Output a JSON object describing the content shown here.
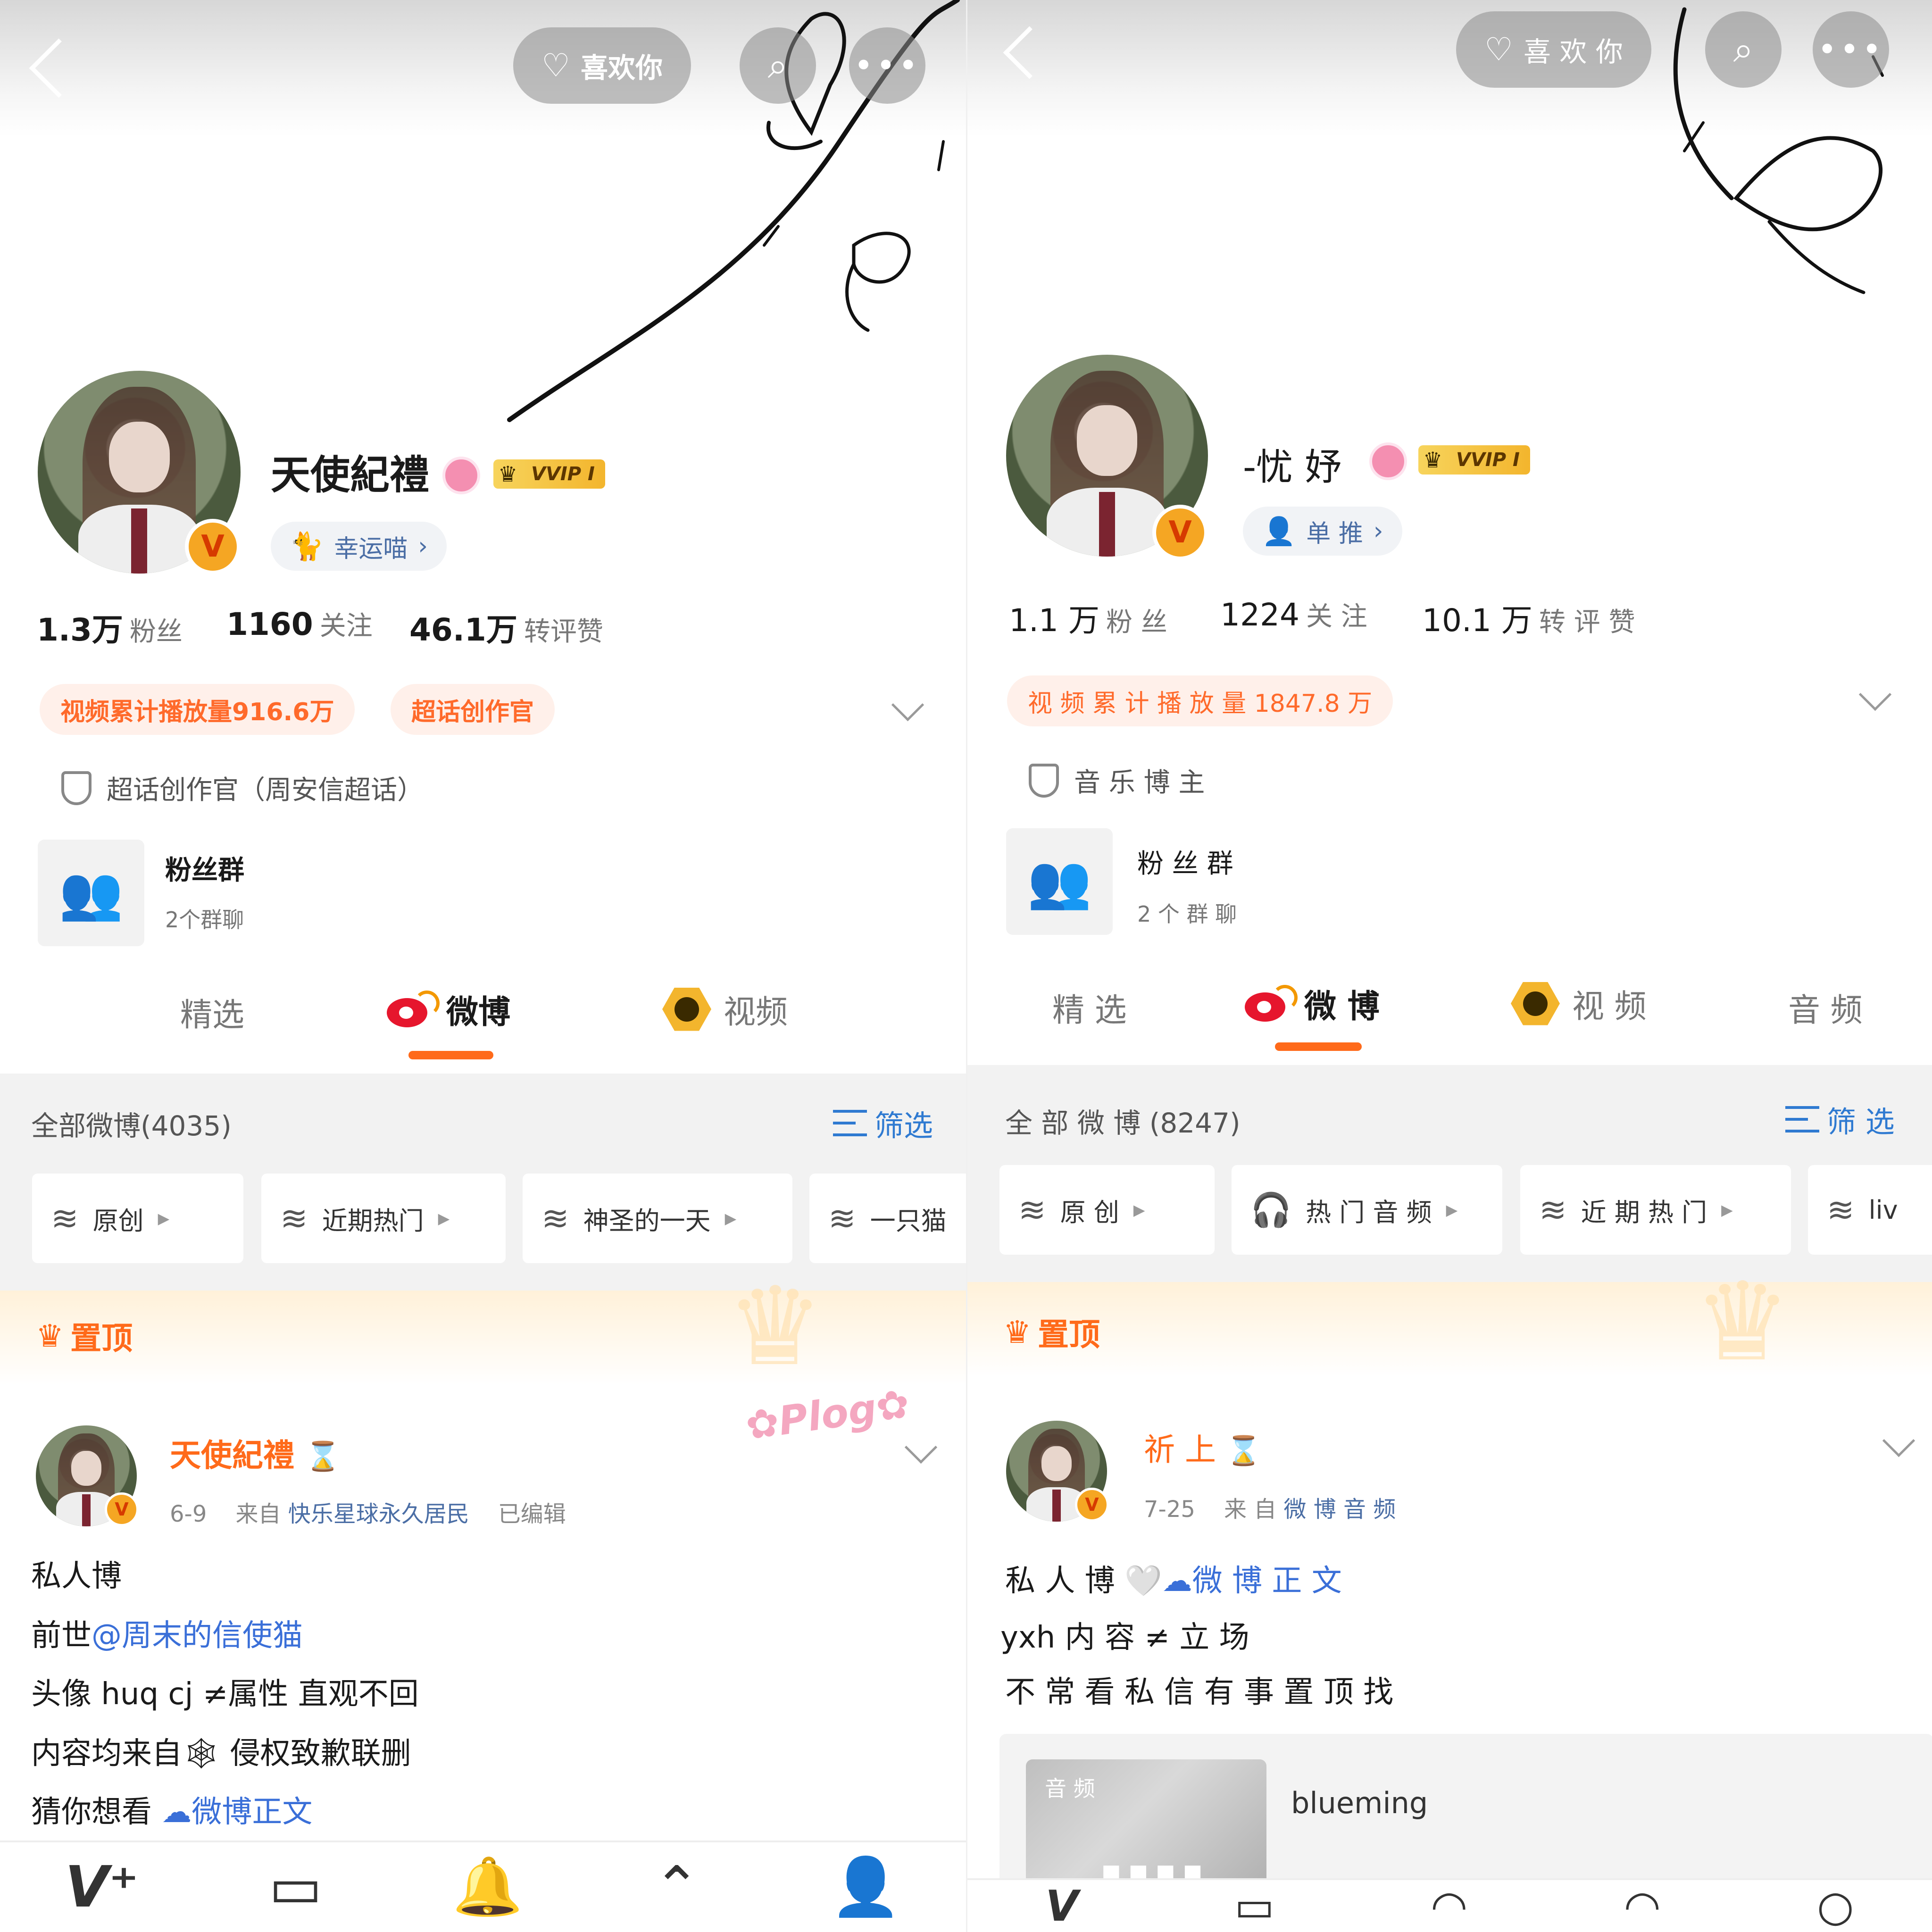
{
  "left": {
    "header": {
      "like_label": "喜欢你",
      "back_icon": "back-icon",
      "search_icon": "search-icon",
      "more_icon": "more-icon"
    },
    "profile": {
      "name": "天使紀禮",
      "vvip_label": "VVIP I",
      "tag_label": "幸运喵",
      "stats": [
        {
          "value": "1.3万",
          "label": "粉丝"
        },
        {
          "value": "1160",
          "label": "关注"
        },
        {
          "value": "46.1万",
          "label": "转评赞"
        }
      ],
      "badges": [
        "视频累计播放量916.6万",
        "超话创作官"
      ],
      "certification": "超话创作官（周安信超话）",
      "fan_group": {
        "title": "粉丝群",
        "subtitle": "2个群聊"
      }
    },
    "tabs": [
      "精选",
      "微博",
      "视频"
    ],
    "feed": {
      "all_count": "全部微博(4035)",
      "filter_label": "筛选",
      "chips": [
        "原创",
        "近期热门",
        "神圣的一天",
        "一只猫"
      ],
      "pinned_label": "置顶",
      "post": {
        "author": "天使紀禮",
        "date": "6-9",
        "from_label": "来自",
        "source": "快乐星球永久居民",
        "edited": "已编辑",
        "lines": [
          {
            "text": "私人博"
          },
          {
            "prefix": "前世",
            "link": "@周末的信使猫"
          },
          {
            "text": "头像 huq cj ≠属性 直观不回"
          },
          {
            "prefix": "内容均来自",
            "icon": "🕸",
            "suffix": " 侵权致歉联删"
          },
          {
            "prefix": "猜你想看 ",
            "link": "☁微博正文"
          }
        ]
      }
    }
  },
  "right": {
    "header": {
      "like_label": "喜 欢 你"
    },
    "profile": {
      "name": "-忧 妤",
      "vvip_label": "VVIP I",
      "tag_label": "单 推",
      "stats": [
        {
          "value": "1.1 万",
          "label": "粉 丝"
        },
        {
          "value": "1224",
          "label": "关 注"
        },
        {
          "value": "10.1 万",
          "label": "转 评 赞"
        }
      ],
      "badges": [
        "视 频 累 计 播 放 量 1847.8 万"
      ],
      "certification": "音 乐 博 主",
      "fan_group": {
        "title": "粉 丝 群",
        "subtitle": "2 个 群 聊"
      }
    },
    "tabs": [
      "精 选",
      "微 博",
      "视 频",
      "音 频"
    ],
    "feed": {
      "all_count": "全 部 微 博 (8247)",
      "filter_label": "筛 选",
      "chips": [
        "原 创",
        "热 门 音 频",
        "近 期 热 门",
        "liv"
      ],
      "pinned_label": "置顶",
      "post": {
        "author": "祈 上",
        "date": "7-25",
        "from_label": "来 自",
        "source": "微 博 音 频",
        "lines": [
          {
            "prefix": "私 人 博 🤍",
            "link": "☁微 博 正 文"
          },
          {
            "text": "yxh 内 容 ≠ 立 场"
          },
          {
            "text": "不 常 看 私 信  有 事 置 顶 找"
          }
        ],
        "audio": {
          "tag": "音 频",
          "title": "blueming"
        }
      }
    }
  }
}
